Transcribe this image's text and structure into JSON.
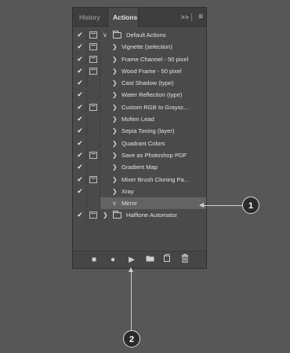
{
  "tabs": {
    "history": "History",
    "actions": "Actions",
    "collapse": ">>",
    "menu": "≡"
  },
  "actions_list": [
    {
      "label": "Default Actions",
      "type": "set",
      "checked": true,
      "dialog": true,
      "expanded": true
    },
    {
      "label": "Vignette (selection)",
      "type": "action",
      "checked": true,
      "dialog": true
    },
    {
      "label": "Frame Channel - 50 pixel",
      "type": "action",
      "checked": true,
      "dialog": true
    },
    {
      "label": "Wood Frame - 50 pixel",
      "type": "action",
      "checked": true,
      "dialog": true
    },
    {
      "label": "Cast Shadow (type)",
      "type": "action",
      "checked": true,
      "dialog": false
    },
    {
      "label": "Water Reflection (type)",
      "type": "action",
      "checked": true,
      "dialog": false
    },
    {
      "label": "Custom RGB to Graysc...",
      "type": "action",
      "checked": true,
      "dialog": true
    },
    {
      "label": "Molten Lead",
      "type": "action",
      "checked": true,
      "dialog": false
    },
    {
      "label": "Sepia Toning (layer)",
      "type": "action",
      "checked": true,
      "dialog": false
    },
    {
      "label": "Quadrant Colors",
      "type": "action",
      "checked": true,
      "dialog": false
    },
    {
      "label": "Save as Photoshop PDF",
      "type": "action",
      "checked": true,
      "dialog": true
    },
    {
      "label": "Gradient Map",
      "type": "action",
      "checked": true,
      "dialog": false
    },
    {
      "label": "Mixer Brush Cloning Pa...",
      "type": "action",
      "checked": true,
      "dialog": true
    },
    {
      "label": "Xray",
      "type": "action",
      "checked": true,
      "dialog": false
    },
    {
      "label": "Mirror",
      "type": "action",
      "checked": false,
      "dialog": false,
      "selected": true,
      "expanded": true
    },
    {
      "label": "Halftone Automator",
      "type": "set",
      "checked": true,
      "dialog": true,
      "expanded": false
    }
  ],
  "bottom_toolbar": {
    "stop_icon": "stop-icon",
    "record_icon": "record-icon",
    "play_icon": "play-icon",
    "new_set_icon": "folder-icon",
    "new_action_icon": "new-action-icon",
    "delete_icon": "trash-icon"
  },
  "callouts": {
    "one": "1",
    "two": "2"
  }
}
